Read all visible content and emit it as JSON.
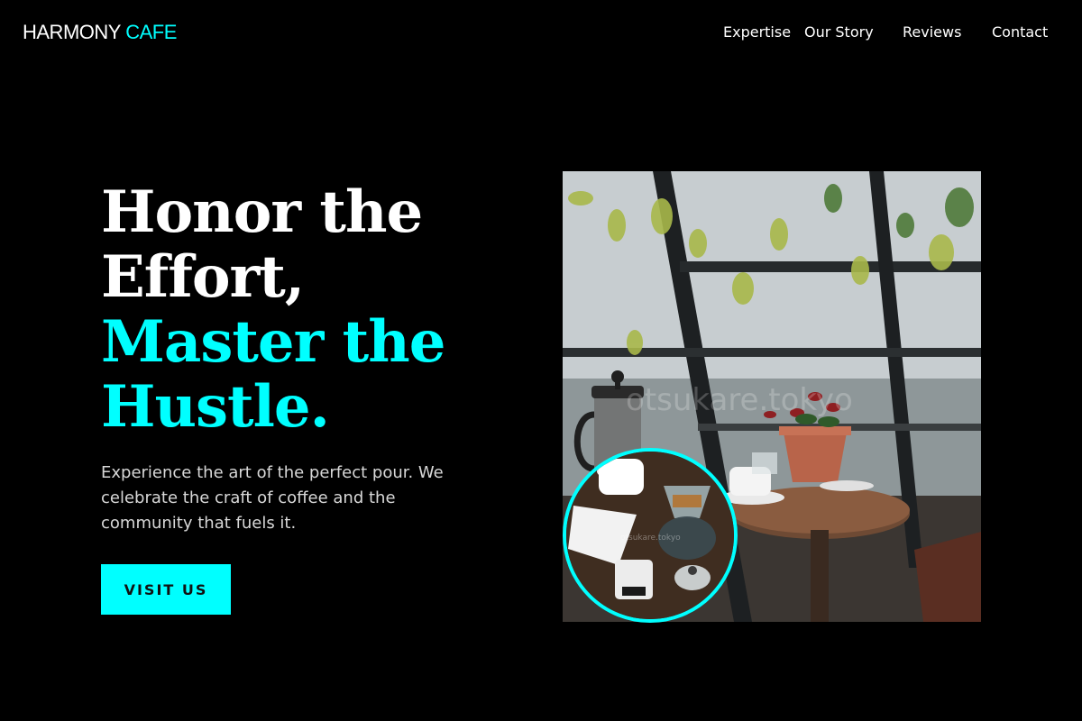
{
  "brand": {
    "name": "HARMONY",
    "accent": "CAFE",
    "accent_color": "#00ffff"
  },
  "nav": {
    "items": [
      {
        "label": "Expertise"
      },
      {
        "label": "Our Story"
      },
      {
        "label": "Reviews"
      },
      {
        "label": "Contact"
      }
    ]
  },
  "hero": {
    "headline_line1": "Honor the",
    "headline_line2": "Effort,",
    "headline_accent_line1": "Master the",
    "headline_accent_line2": "Hustle.",
    "description": "Experience the art of the perfect pour. We celebrate the craft of coffee and the community that fuels it.",
    "cta_label": "VISIT US"
  },
  "images": {
    "main_watermark": "otsukare.tokyo",
    "inset_watermark": "otsukare.tokyo"
  }
}
